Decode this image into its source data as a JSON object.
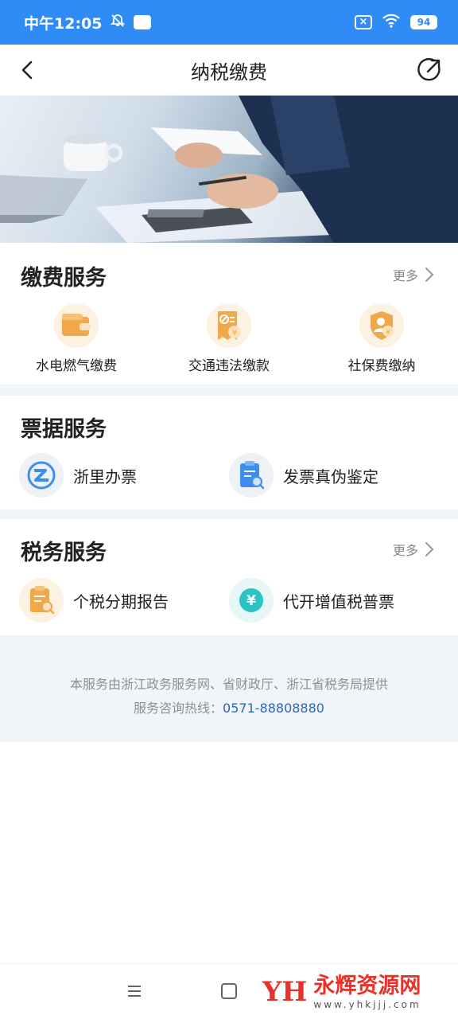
{
  "status_bar": {
    "time": "中午12:05",
    "battery": "94"
  },
  "header": {
    "title": "纳税缴费"
  },
  "payment_section": {
    "title": "缴费服务",
    "more_label": "更多",
    "items": [
      {
        "label": "水电燃气缴费",
        "icon": "wallet-icon"
      },
      {
        "label": "交通违法缴款",
        "icon": "traffic-fine-icon"
      },
      {
        "label": "社保费缴纳",
        "icon": "social-security-icon"
      }
    ]
  },
  "invoice_section": {
    "title": "票据服务",
    "items": [
      {
        "label": "浙里办票",
        "icon": "zheli-logo-icon"
      },
      {
        "label": "发票真伪鉴定",
        "icon": "invoice-check-icon"
      }
    ]
  },
  "tax_section": {
    "title": "税务服务",
    "more_label": "更多",
    "items": [
      {
        "label": "个税分期报告",
        "icon": "tax-report-icon"
      },
      {
        "label": "代开增值税普票",
        "icon": "yuan-icon"
      }
    ]
  },
  "info": {
    "provider": "本服务由浙江政务服务网、省财政厅、浙江省税务局提供",
    "hotline_label": "服务咨询热线：",
    "hotline_number": "0571-88808880"
  },
  "watermark": {
    "logo": "YH",
    "main": "永辉资源网",
    "sub": "www.yhkjjj.com"
  },
  "colors": {
    "status_bar": "#2f8bf5",
    "accent_orange": "#f0a94a",
    "accent_blue": "#3d8ef0",
    "teal": "#2bc3c5",
    "hotline": "#2e66b8",
    "watermark_red": "#e6322a"
  }
}
